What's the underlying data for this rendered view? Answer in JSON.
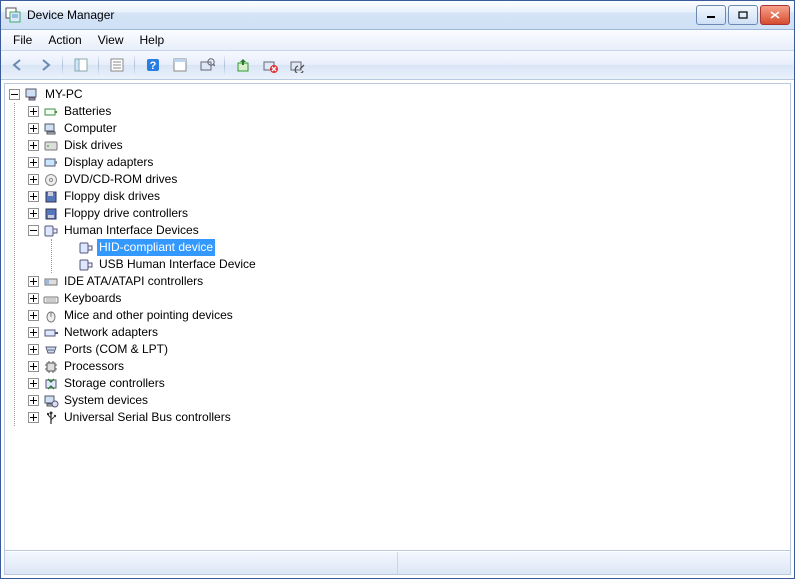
{
  "title": "Device Manager",
  "menu": {
    "file": "File",
    "action": "Action",
    "view": "View",
    "help": "Help"
  },
  "root": "MY-PC",
  "nodes": {
    "batteries": "Batteries",
    "computer": "Computer",
    "disk": "Disk drives",
    "display": "Display adapters",
    "dvd": "DVD/CD-ROM drives",
    "floppy_disk": "Floppy disk drives",
    "floppy_ctrl": "Floppy drive controllers",
    "hid": "Human Interface Devices",
    "hid_compliant": "HID-compliant device",
    "hid_usb": "USB Human Interface Device",
    "ide": "IDE ATA/ATAPI controllers",
    "keyboards": "Keyboards",
    "mice": "Mice and other pointing devices",
    "network": "Network adapters",
    "ports": "Ports (COM & LPT)",
    "processors": "Processors",
    "storage": "Storage controllers",
    "system": "System devices",
    "usb": "Universal Serial Bus controllers"
  }
}
